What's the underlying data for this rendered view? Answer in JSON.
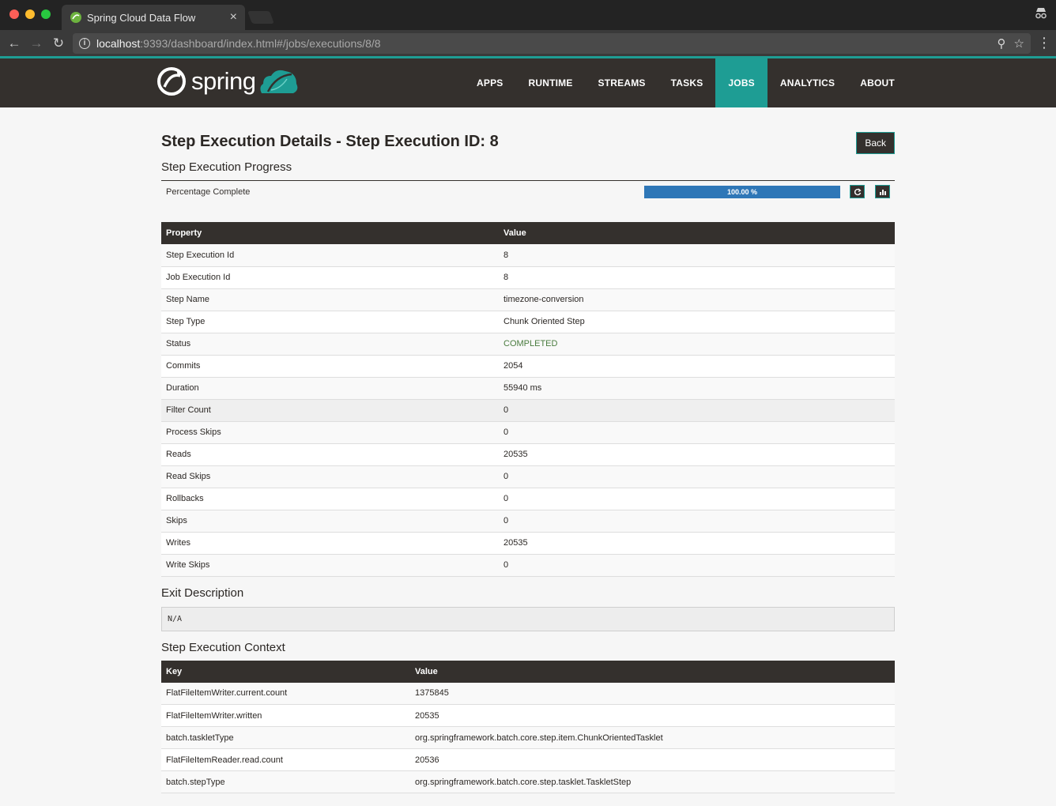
{
  "browser": {
    "tab_title": "Spring Cloud Data Flow",
    "url_host": "localhost",
    "url_path": ":9393/dashboard/index.html#/jobs/executions/8/8"
  },
  "app": {
    "logo_text": "spring",
    "nav": [
      "APPS",
      "RUNTIME",
      "STREAMS",
      "TASKS",
      "JOBS",
      "ANALYTICS",
      "ABOUT"
    ],
    "active_nav": "JOBS",
    "accent_color": "#1e9d94",
    "navbar_color": "#34302d"
  },
  "page": {
    "title": "Step Execution Details - Step Execution ID: 8",
    "back_label": "Back",
    "progress_heading": "Step Execution Progress",
    "progress_label": "Percentage Complete",
    "progress_text": "100.00 %",
    "progress_value": 100,
    "refresh_icon": "refresh-icon",
    "chart_icon": "bar-chart-icon",
    "props_headers": [
      "Property",
      "Value"
    ],
    "props": [
      [
        "Step Execution Id",
        "8"
      ],
      [
        "Job Execution Id",
        "8"
      ],
      [
        "Step Name",
        "timezone-conversion"
      ],
      [
        "Step Type",
        "Chunk Oriented Step"
      ],
      [
        "Status",
        "COMPLETED"
      ],
      [
        "Commits",
        "2054"
      ],
      [
        "Duration",
        "55940 ms"
      ],
      [
        "Filter Count",
        "0"
      ],
      [
        "Process Skips",
        "0"
      ],
      [
        "Reads",
        "20535"
      ],
      [
        "Read Skips",
        "0"
      ],
      [
        "Rollbacks",
        "0"
      ],
      [
        "Skips",
        "0"
      ],
      [
        "Writes",
        "20535"
      ],
      [
        "Write Skips",
        "0"
      ]
    ],
    "status_color": "#4a7c3f",
    "exit_heading": "Exit Description",
    "exit_text": "N/A",
    "context_heading": "Step Execution Context",
    "context_headers": [
      "Key",
      "Value"
    ],
    "context": [
      [
        "FlatFileItemWriter.current.count",
        "1375845"
      ],
      [
        "FlatFileItemWriter.written",
        "20535"
      ],
      [
        "batch.taskletType",
        "org.springframework.batch.core.step.item.ChunkOrientedTasklet"
      ],
      [
        "FlatFileItemReader.read.count",
        "20536"
      ],
      [
        "batch.stepType",
        "org.springframework.batch.core.step.tasklet.TaskletStep"
      ]
    ]
  }
}
